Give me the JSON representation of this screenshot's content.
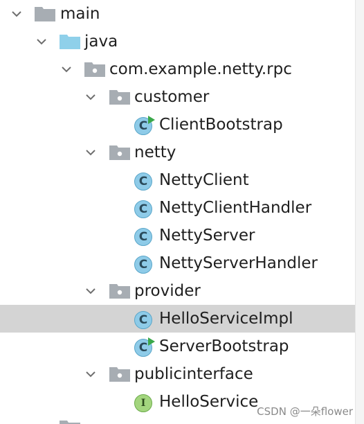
{
  "tree": {
    "main": "main",
    "java": "java",
    "package": "com.example.netty.rpc",
    "customer": "customer",
    "client_bootstrap": "ClientBootstrap",
    "netty": "netty",
    "netty_client": "NettyClient",
    "netty_client_handler": "NettyClientHandler",
    "netty_server": "NettyServer",
    "netty_server_handler": "NettyServerHandler",
    "provider": "provider",
    "hello_service_impl": "HelloServiceImpl",
    "server_bootstrap": "ServerBootstrap",
    "publicinterface": "publicinterface",
    "hello_service": "HelloService"
  },
  "badges": {
    "class_letter": "C",
    "interface_letter": "I"
  },
  "watermark": "CSDN @一朵flower",
  "colors": {
    "selection": "#d4d4d4",
    "class_icon": "#8ecbe8",
    "interface_icon": "#a3d57e",
    "folder_gray": "#a7adb3",
    "source_folder": "#8fd0ea",
    "run_badge": "#3aa84a"
  }
}
